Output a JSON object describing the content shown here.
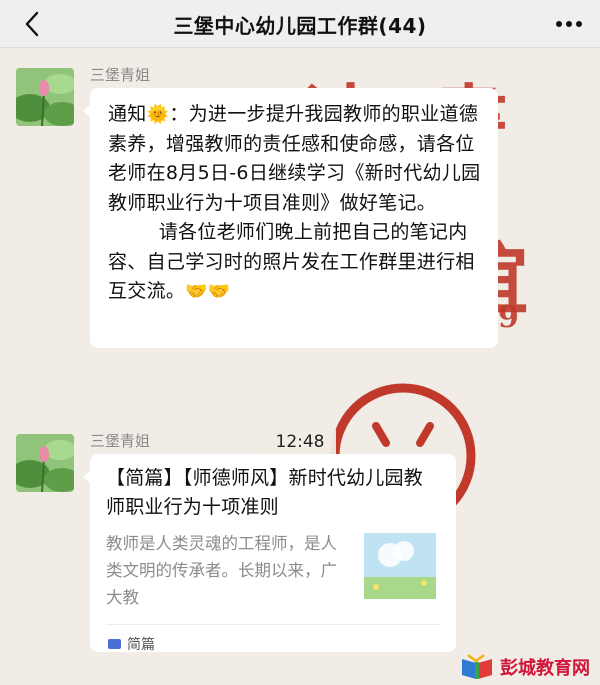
{
  "header": {
    "title": "三堡中心幼儿园工作群(44)"
  },
  "messages": [
    {
      "sender": "三堡青姐",
      "text_prefix": "通知",
      "emoji": "🌞",
      "text": "：为进一步提升我园教师的职业道德素养，增强教师的责任感和使命感，请各位老师在8月5日-6日继续学习《新时代幼儿园教师职业行为十项目准则》做好笔记。\n        请各位老师们晚上前把自己的笔记内容、自己学习时的照片发在工作群里进行相互交流。",
      "emoji_tail": "🤝🤝"
    }
  ],
  "timestamp": "12:48",
  "link_card": {
    "sender": "三堡青姐",
    "title": "【简篇】【师德师风】新时代幼儿园教师职业行为十项准则",
    "description": "教师是人类灵魂的工程师，是人类文明的传承者。长期以来，广大教",
    "source": "简篇"
  },
  "watermark": {
    "text": "彭城教育网"
  },
  "wallpaper": {
    "glyphs": [
      "读",
      "書",
      "谊",
      "9"
    ]
  },
  "colors": {
    "accent_red": "#c0392b",
    "bubble": "#ffffff",
    "background": "#f1ece5"
  }
}
